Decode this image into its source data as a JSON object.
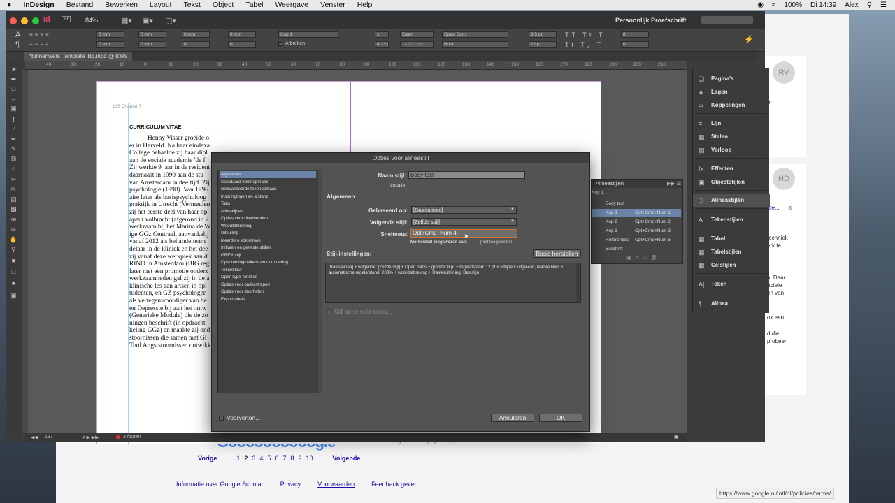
{
  "menubar": {
    "apple": "",
    "app": "InDesign",
    "items": [
      "Bestand",
      "Bewerken",
      "Layout",
      "Tekst",
      "Object",
      "Tabel",
      "Weergave",
      "Venster",
      "Help"
    ],
    "battery": "100%",
    "clock": "Di 14:39",
    "user": "Alex"
  },
  "app": {
    "zoom": "84%",
    "workspace": "Persoonlijk Proefschrift",
    "document_tab": "*binnenwerk_template_B5.indd @ 83%"
  },
  "control": {
    "style_value": "Kop 1",
    "hyphenate": "Afbreken",
    "font": "Open Sans",
    "font_style": "Bold",
    "size": "9,5 pt",
    "leading": "12 pt",
    "align_none": "Geen",
    "value1": "1",
    "value2": "4,233",
    "value3": "14,872 mm",
    "zero_mm": "0 mm",
    "zero": "0"
  },
  "ruler": [
    "40",
    "30",
    "20",
    "10",
    "0",
    "10",
    "20",
    "30",
    "40",
    "50",
    "60",
    "70",
    "80",
    "90",
    "100",
    "110",
    "120",
    "130",
    "140",
    "150",
    "160",
    "170",
    "180",
    "190",
    "200",
    "210"
  ],
  "page": {
    "running_head": "136   Chapter 7",
    "heading": "CURRICULUM VITAE",
    "lines": [
      "Henny Visser groeide o",
      "er in Herveld. Na haar eindexa",
      "College behaalde zij haar dipl",
      "aan de sociale academie 'de f",
      "Zij werkte 9 jaar in de resident",
      "daarnaast in 1990 aan de stu",
      "van Amsterdam in deeltijd. Zij",
      "psychologie (1998). Van 1996",
      "aire later als basispsycholoog",
      "praktijk in Utrecht (Vermeulen",
      "zij het eerste deel van haar op",
      "apeut volbracht (afgerond in 2",
      "werkzaam bij het Marina de W",
      "ige GGz Centraal, aanvankelij",
      "vanaf 2012 als behandelteam",
      "delaar in de kliniek en het dee",
      "zij vanaf deze werkplek aan d",
      "RINO in Amsterdam (BIG regi",
      "later met een promotie onderz",
      "werkzaamheden gaf zij in de a",
      "klinische les aan artsen in opl",
      "tudenten, en GZ psychologen",
      "als vertegenwoordiger van he",
      "en Depressie bij aan het ontw",
      "(Generieke Module) die de zo",
      "ningen beschrift (in opdracht",
      "keling GGz) en maakte zij ond",
      "stoornissen die samen met Gl",
      "Tool Angststoornissen ontwikk"
    ],
    "footer_text": "nivang. Aur Stichting vijver 2008, 1 Ae-Ze"
  },
  "statusbar": {
    "page": "137",
    "errors": "3 fouten"
  },
  "dialog": {
    "title": "Opties voor alineastijl",
    "categories": [
      "Algemeen",
      "Standaard tekenopmaak",
      "Geavanceerde tekenopmaak",
      "Inspringingen en afstand",
      "Tabs",
      "Alinealijnen",
      "Opties voor bijenhouden",
      "Woordafbreking",
      "Uitvulling",
      "Meerdere kolommen",
      "Initialen en geneste stijlen",
      "GREP-stijl",
      "Opsommingstekens en nummering",
      "Tekenkleur",
      "OpenType-functies",
      "Opties voor onderstrepen",
      "Opties voor doorhalen",
      "Exportlabels"
    ],
    "selected_category": "Algemeen",
    "name_label": "Naam stijl:",
    "name_value": "Body text",
    "location_label": "Locatie:",
    "general_heading": "Algemeen",
    "based_on_label": "Gebaseerd op:",
    "based_on_value": "[Basisalinea]",
    "next_style_label": "Volgende stijl:",
    "next_style_value": "[Zelfde stijl]",
    "shortcut_label": "Sneltoets:",
    "shortcut_value": "Opt+Cmd+Num 4",
    "assigned_label": "Momenteel toegewezen aan:",
    "assigned_value": "[niet toegewezen]",
    "settings_heading": "Stijl-instellingen:",
    "reset_button": "Basis herstellen",
    "settings_text": "[Basisalinea] + volgende: [Zelfde stijl] + Open Sans + grootte: 8 pt + regelafstand: 12 pt + uitlijnen: uitgevuld, laatste links + automatische regelafstand: 200% + woordafbreking + Rasteruitlijning:  Basislijn",
    "apply_checkbox": "Stijl op selectie toepa...",
    "preview_label": "Voorverton...",
    "cancel_button": "Annuleren",
    "ok_button": "OK"
  },
  "paragraph_styles_panel": {
    "title": "Alineastijlen",
    "current": "Kop 1",
    "rows": [
      {
        "name": "Body text",
        "key": ""
      },
      {
        "name": "Kop 1",
        "key": "Opt+Cmd+Num 1"
      },
      {
        "name": "Kop 2",
        "key": "Opt+Cmd+Num 2"
      },
      {
        "name": "Kop 3",
        "key": "Opt+Cmd+Num 3"
      },
      {
        "name": "Referenties",
        "key": "Opt+Cmd+Num 5"
      },
      {
        "name": "Bijschrift",
        "key": ""
      }
    ]
  },
  "dock": {
    "items": [
      "Pagina's",
      "Lagen",
      "Koppelingen",
      "Lijn",
      "Stalen",
      "Verloop",
      "Effecten",
      "Objectstijlen",
      "Alineastijlen",
      "Tekenstijlen",
      "Tabel",
      "Tabelstijlen",
      "Celstijlen",
      "Teken",
      "Alinea"
    ]
  },
  "browser": {
    "prev": "Vorige",
    "pages": [
      "1",
      "2",
      "3",
      "4",
      "5",
      "6",
      "7",
      "8",
      "9",
      "10"
    ],
    "current_page": "2",
    "next": "Volgende",
    "footer": [
      "Informatie over Google Scholar",
      "Privacy",
      "Voorwaarden",
      "Feedback geven"
    ],
    "status_url": "https://www.google.nl/intl/nl/policies/terms/",
    "logo": "Goooooooooogle",
    "avatar1": "RV",
    "avatar2": "HD",
    "card_snippets": [
      "or",
      "toe...",
      "techniek",
      "erk te",
      "n. Daar",
      "abiele",
      "en van",
      "ok een",
      "d die",
      "probeer"
    ]
  }
}
